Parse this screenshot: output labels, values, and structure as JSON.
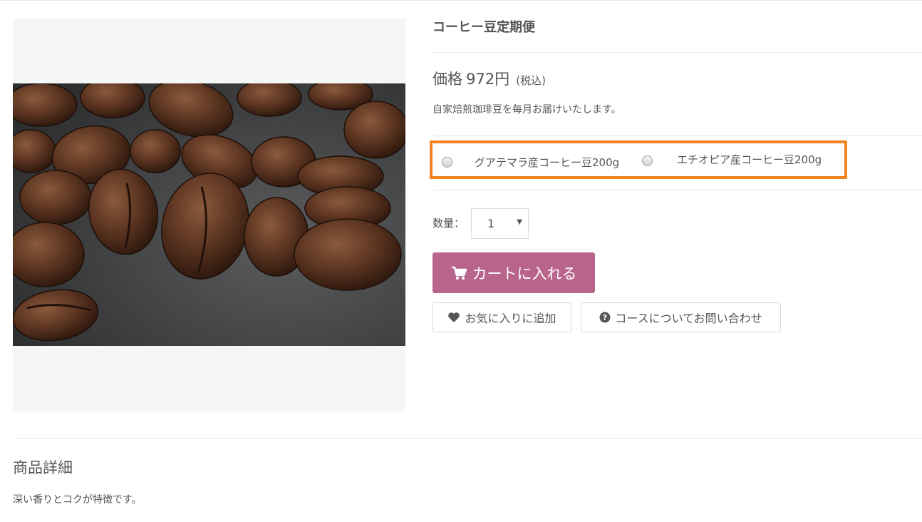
{
  "product": {
    "title": "コーヒー豆定期便",
    "price_label": "価格",
    "price_value": "972円",
    "price_tax": "(税込)",
    "description": "自家焙煎珈琲豆を毎月お届けいたします。",
    "image_alt": "coffee beans photo"
  },
  "options": [
    {
      "label": "グアテマラ産コーヒー豆200g",
      "selected": false
    },
    {
      "label": "エチオピア産コーヒー豆200g",
      "selected": false
    }
  ],
  "quantity": {
    "label": "数量：",
    "value": "1"
  },
  "actions": {
    "cart_label": "カートに入れる",
    "favorite_label": "お気に入りに追加",
    "inquiry_label": "コースについてお問い合わせ"
  },
  "detail": {
    "heading": "商品詳細",
    "text": "深い香りとコクが特徴です。"
  },
  "colors": {
    "cart_button": "#b9648b",
    "highlight_border": "#f58220",
    "text": "#555555"
  },
  "icons": {
    "cart": "cart-icon",
    "favorite": "heart-icon",
    "inquiry": "question-circle-icon"
  }
}
